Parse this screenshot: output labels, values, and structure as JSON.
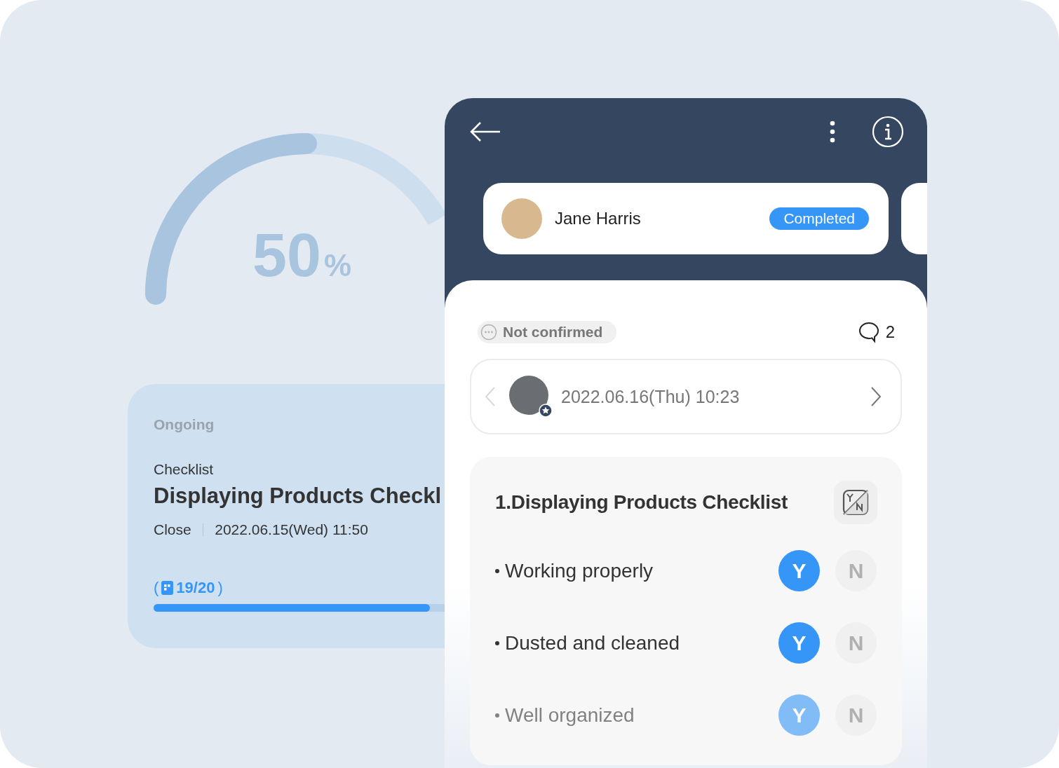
{
  "gauge": {
    "level": 0.5,
    "value": "50",
    "unit": "%"
  },
  "task_card": {
    "status": "Ongoing",
    "category": "Checklist",
    "title": "Displaying Products Checkl",
    "close_label": "Close",
    "close_date": "2022.06.15(Wed) 11:50",
    "progress": {
      "open": "(",
      "count": "19/20",
      "close": ")",
      "level": 0.95
    }
  },
  "detail": {
    "person": {
      "name": "Jane Harris",
      "status": "Completed"
    },
    "confirmation": "Not confirmed",
    "comment_count": "2",
    "submission_date": "2022.06.16(Thu) 10:23",
    "section": {
      "title": "1.Displaying Products Checklist",
      "items": [
        {
          "label": "Working properly",
          "options": [
            {
              "label": "Y",
              "selected": true
            },
            {
              "label": "N",
              "selected": false
            }
          ]
        },
        {
          "label": "Dusted and cleaned",
          "options": [
            {
              "label": "Y",
              "selected": true
            },
            {
              "label": "N",
              "selected": false
            }
          ]
        },
        {
          "label": "Well organized",
          "options": [
            {
              "label": "Y",
              "selected": true
            },
            {
              "label": "N",
              "selected": false
            }
          ]
        }
      ]
    }
  }
}
